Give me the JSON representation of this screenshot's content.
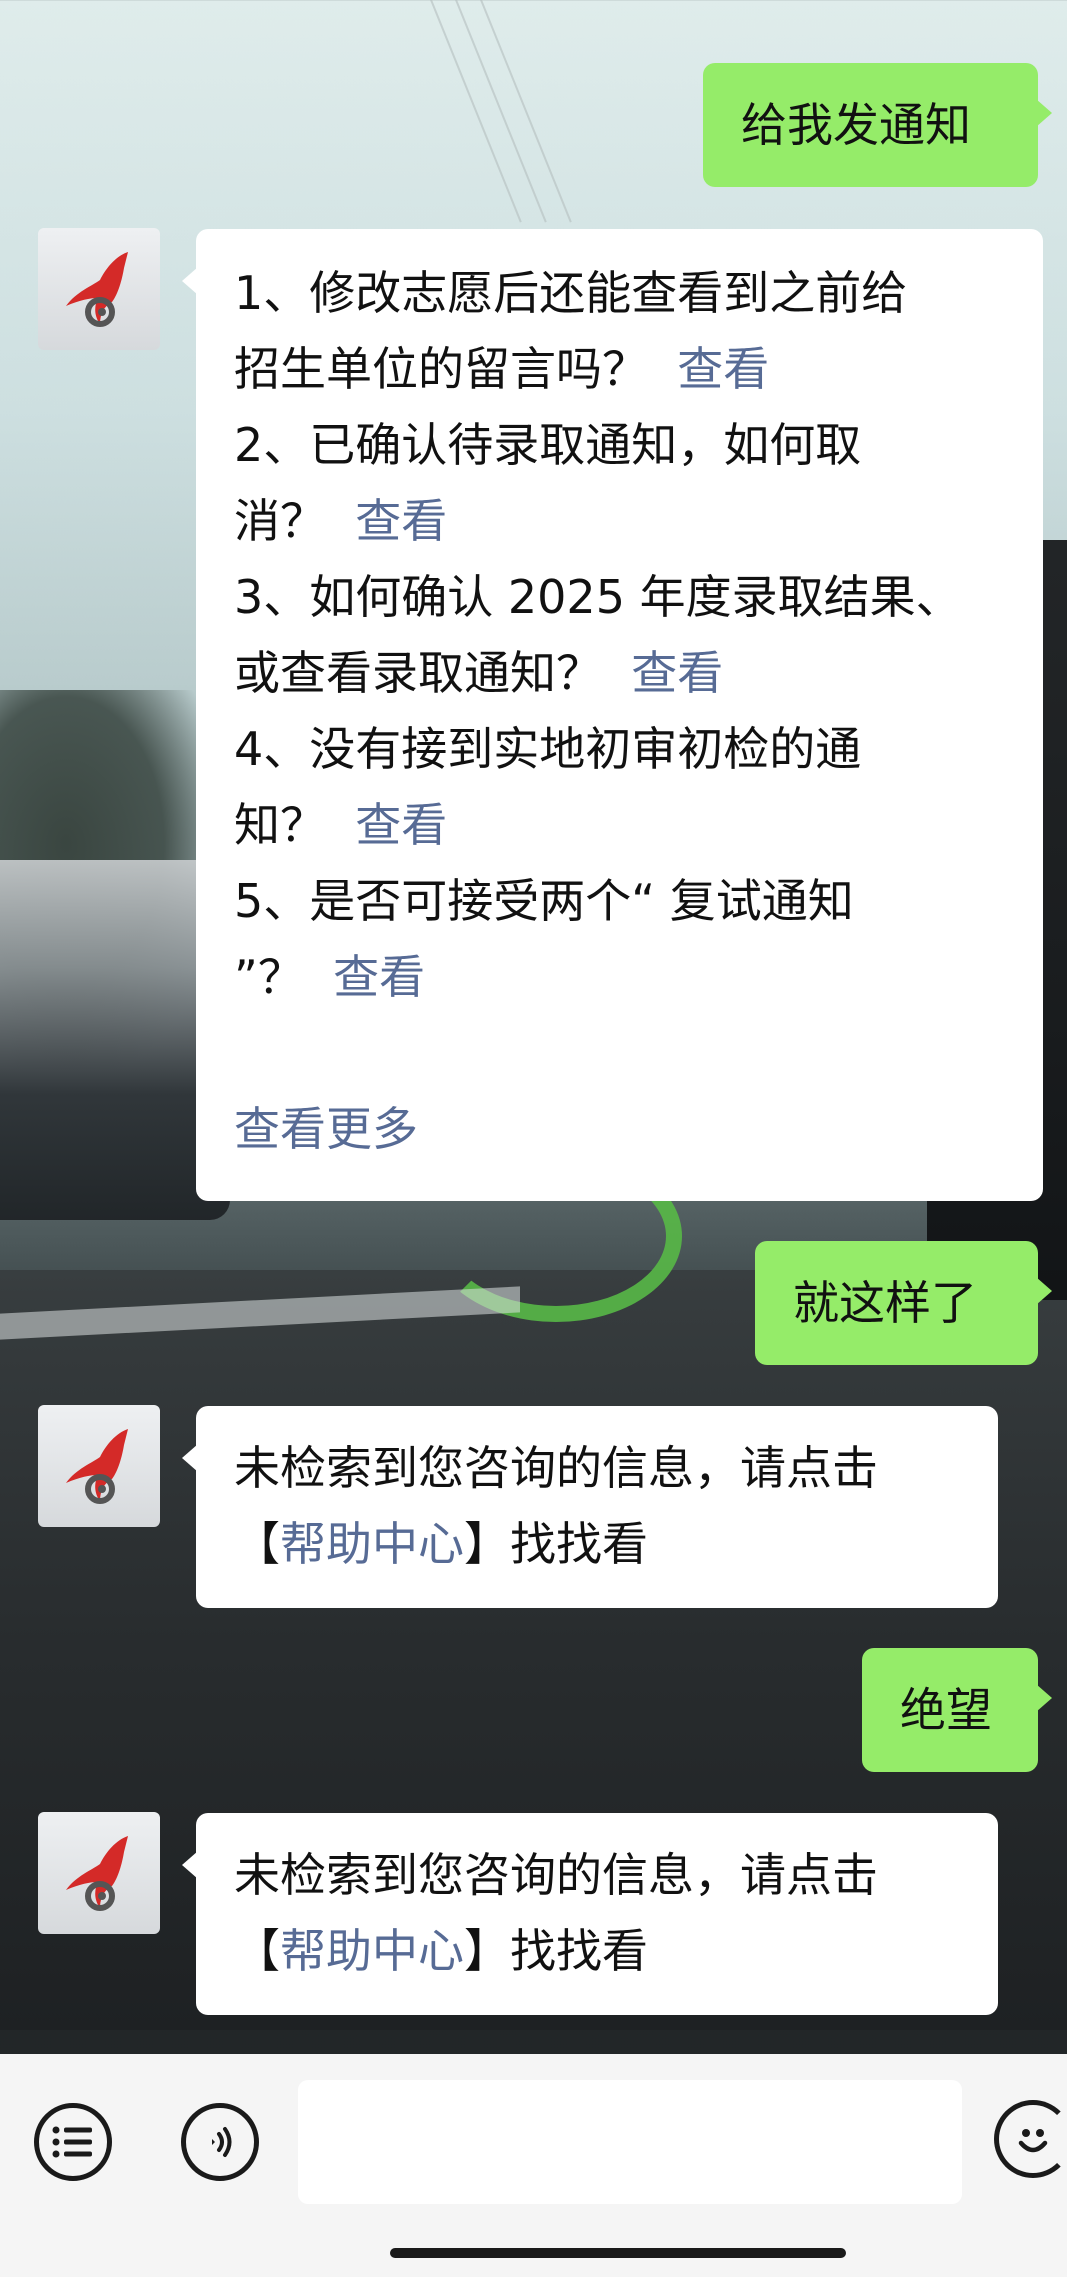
{
  "messages": {
    "m1": {
      "text": "给我发通知"
    },
    "m2": {
      "faqs": [
        {
          "line1": "1、修改志愿后还能查看到之前给",
          "line2": "招生单位的留言吗？",
          "link": "查看"
        },
        {
          "line1": "2、已确认待录取通知，如何取",
          "line2": "消？",
          "link": "查看"
        },
        {
          "line1": "3、如何确认 2025 年度录取结果、",
          "line2": "或查看录取通知？",
          "link": "查看"
        },
        {
          "line1": "4、没有接到实地初审初检的通",
          "line2": "知？",
          "link": "查看"
        },
        {
          "line1": "5、是否可接受两个“ 复试通知",
          "line2": "”？",
          "link": "查看"
        }
      ],
      "more": "查看更多"
    },
    "m3": {
      "text": "就这样了"
    },
    "m4": {
      "line1": "未检索到您咨询的信息，请点击",
      "bracket_open": "【",
      "link": "帮助中心",
      "bracket_close": "】",
      "tail": "找找看"
    },
    "m5": {
      "text": "绝望"
    },
    "m6": {
      "line1": "未检索到您咨询的信息，请点击",
      "bracket_open": "【",
      "link": "帮助中心",
      "bracket_close": "】",
      "tail": "找找看"
    }
  },
  "input_bar": {
    "menu_icon": "list-menu-icon",
    "voice_icon": "voice-icon",
    "emoji_icon": "emoji-icon",
    "placeholder": ""
  },
  "colors": {
    "self_bubble": "#95ec69",
    "bot_bubble": "#ffffff",
    "link": "#576b95",
    "input_bar": "#f5f5f5",
    "avatar_logo_red": "#d42a28"
  }
}
